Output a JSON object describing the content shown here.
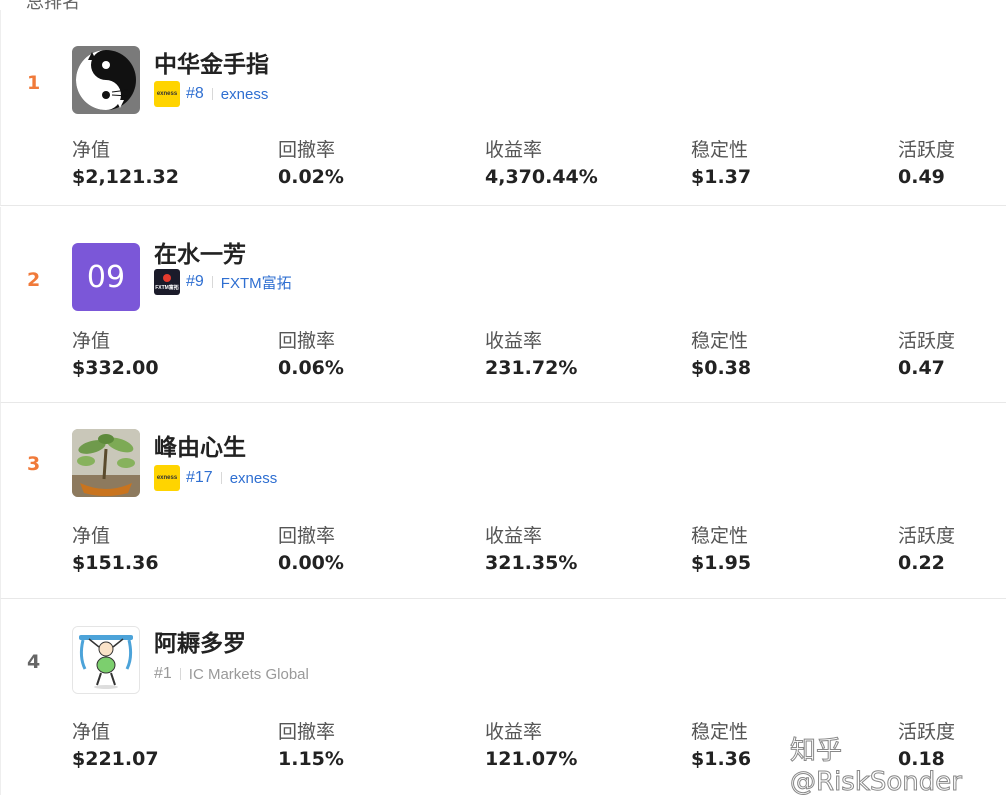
{
  "header": {
    "partial_label": "总排名"
  },
  "stat_labels": [
    "净值",
    "回撤率",
    "收益率",
    "稳定性",
    "活跃度"
  ],
  "traders": [
    {
      "rank": "1",
      "name": "中华金手指",
      "rank_tag": "#8",
      "broker": "exness",
      "broker_logo_text": "exness",
      "avatar_icon": "yin-yang-cat-icon",
      "stats": [
        "$2,121.32",
        "0.02%",
        "4,370.44%",
        "$1.37",
        "0.49"
      ]
    },
    {
      "rank": "2",
      "name": "在水一芳",
      "rank_tag": "#9",
      "broker": "FXTM富拓",
      "broker_logo_text": "FXTM富拓",
      "avatar_text": "09",
      "avatar_color": "#7b57d8",
      "stats": [
        "$332.00",
        "0.06%",
        "231.72%",
        "$0.38",
        "0.47"
      ]
    },
    {
      "rank": "3",
      "name": "峰由心生",
      "rank_tag": "#17",
      "broker": "exness",
      "broker_logo_text": "exness",
      "avatar_icon": "potted-plant-icon",
      "stats": [
        "$151.36",
        "0.00%",
        "321.35%",
        "$1.95",
        "0.22"
      ]
    },
    {
      "rank": "4",
      "name": "阿耨多罗",
      "rank_tag": "#1",
      "broker": "IC Markets Global",
      "avatar_icon": "cartoon-lifter-icon",
      "stats": [
        "$221.07",
        "1.15%",
        "121.07%",
        "$1.36",
        "0.18"
      ]
    }
  ],
  "watermark": "知乎 @RiskSonder",
  "colors": {
    "rank_accent": "#f07a3a",
    "link_blue": "#2f6fd1",
    "exness_yellow": "#ffd400"
  }
}
